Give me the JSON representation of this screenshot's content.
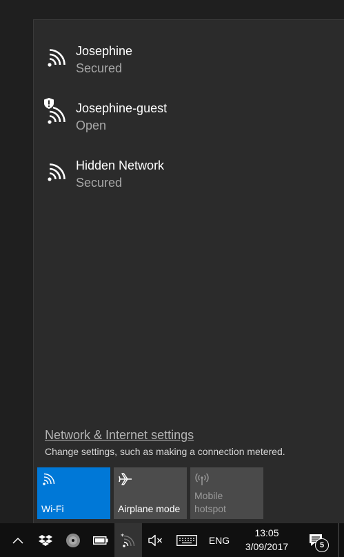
{
  "networks": [
    {
      "name": "Josephine",
      "status": "Secured",
      "icon": "wifi-icon"
    },
    {
      "name": "Josephine-guest",
      "status": "Open",
      "icon": "wifi-warning-icon"
    },
    {
      "name": "Hidden Network",
      "status": "Secured",
      "icon": "wifi-icon"
    }
  ],
  "settings": {
    "link": "Network & Internet settings",
    "description": "Change settings, such as making a connection metered."
  },
  "quick_actions": [
    {
      "label": "Wi-Fi",
      "icon": "wifi-icon",
      "state": "on",
      "color": "#0078d7"
    },
    {
      "label": "Airplane mode",
      "icon": "airplane-icon",
      "state": "off"
    },
    {
      "label": "Mobile\nhotspot",
      "icon": "hotspot-icon",
      "state": "disabled"
    }
  ],
  "taskbar": {
    "language": "ENG",
    "time": "13:05",
    "date": "3/09/2017",
    "notification_count": "5"
  }
}
